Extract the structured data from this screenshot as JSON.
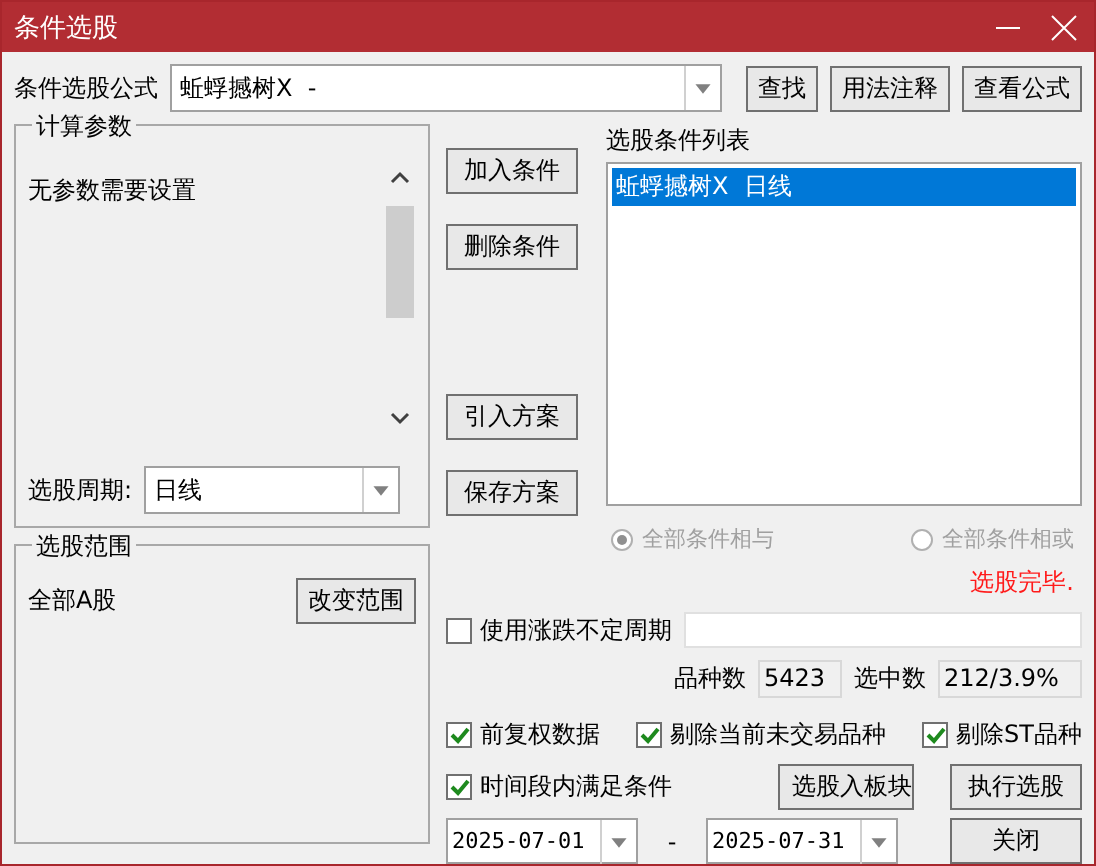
{
  "window": {
    "title": "条件选股"
  },
  "formula": {
    "label": "条件选股公式",
    "value": "蚯蜉撼树X  -"
  },
  "formula_buttons": [
    "查找",
    "用法注释",
    "查看公式"
  ],
  "params": {
    "title": "计算参数",
    "message": "无参数需要设置",
    "period_label": "选股周期:",
    "period_value": "日线"
  },
  "scope": {
    "title": "选股范围",
    "value": "全部A股",
    "button": "改变范围"
  },
  "condition_buttons": {
    "edit": [
      "加入条件",
      "删除条件"
    ],
    "plan": [
      "引入方案",
      "保存方案"
    ]
  },
  "condition_list": {
    "title": "选股条件列表",
    "items": [
      {
        "label": "蚯蜉撼树X  日线",
        "selected": true
      }
    ]
  },
  "logic": [
    {
      "label": "全部条件相与",
      "selected": true,
      "disabled": true
    },
    {
      "label": "全部条件相或",
      "selected": false,
      "disabled": true
    }
  ],
  "status": "选股完毕.",
  "variable_period": {
    "label": "使用涨跌不定周期",
    "checked": false
  },
  "counts": [
    {
      "label": "品种数",
      "value": "5423"
    },
    {
      "label": "选中数",
      "value": "212/3.9%"
    }
  ],
  "options": [
    {
      "label": "前复权数据",
      "checked": true
    },
    {
      "label": "剔除当前未交易品种",
      "checked": true
    },
    {
      "label": "剔除ST品种",
      "checked": true
    }
  ],
  "time_range": {
    "label": "时间段内满足条件",
    "checked": true,
    "start": "2025-07-01",
    "separator": "-",
    "end": "2025-07-31"
  },
  "action_buttons": {
    "top": [
      "选股入板块",
      "执行选股"
    ],
    "bottom": [
      "关闭"
    ]
  }
}
